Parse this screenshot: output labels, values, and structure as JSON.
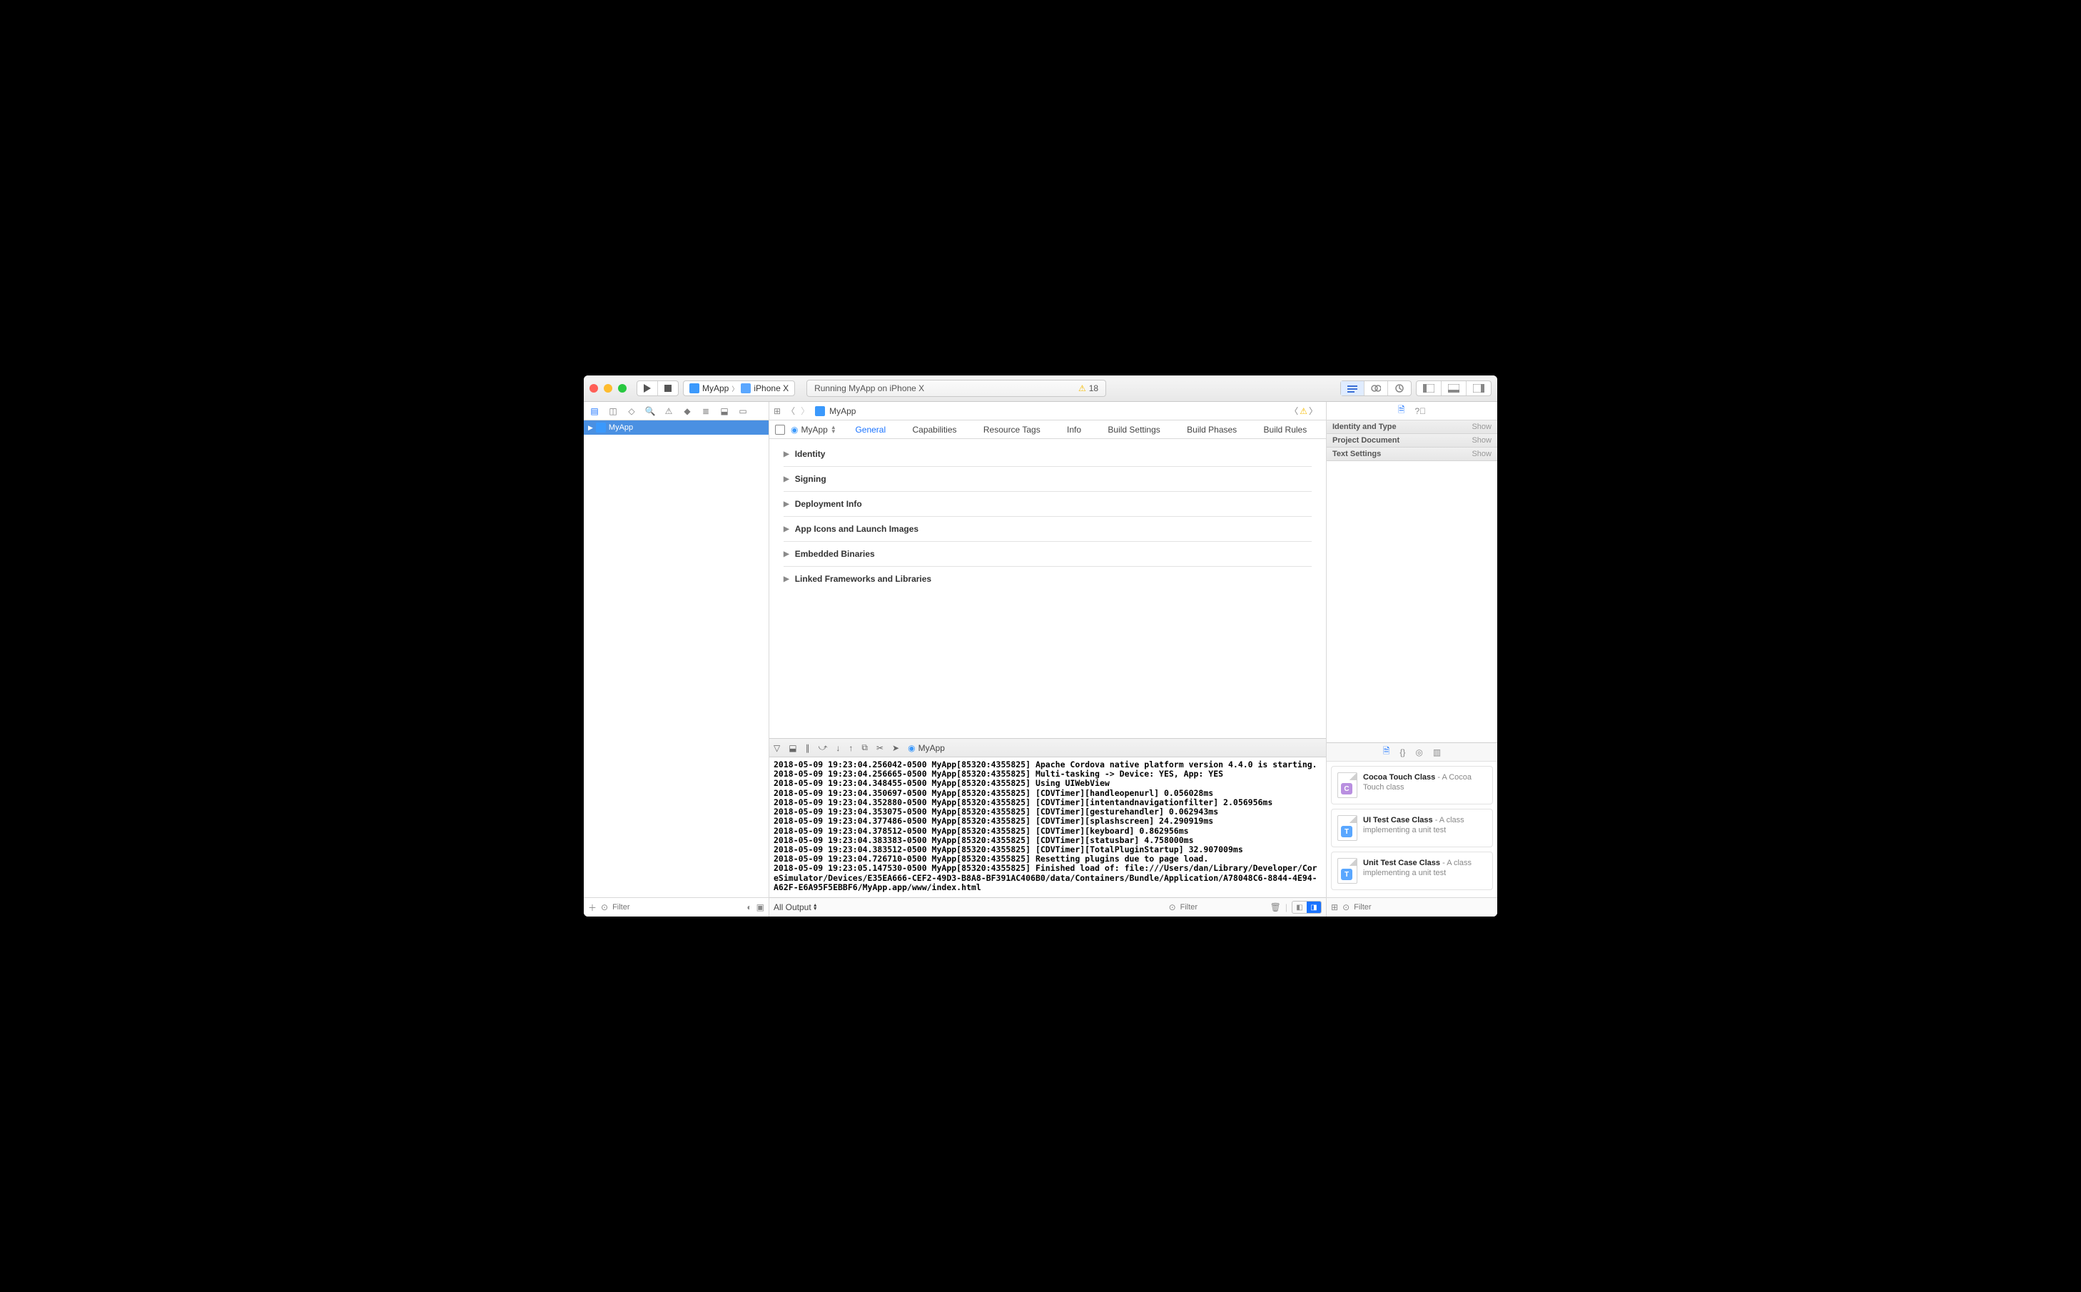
{
  "toolbar": {
    "scheme_app": "MyApp",
    "scheme_device": "iPhone X",
    "status": "Running MyApp on iPhone X",
    "warning_count": "18"
  },
  "jumpbar": {
    "project": "MyApp"
  },
  "navigator": {
    "root": "MyApp",
    "filter_placeholder": "Filter"
  },
  "editor": {
    "target": "MyApp",
    "tabs": [
      "General",
      "Capabilities",
      "Resource Tags",
      "Info",
      "Build Settings",
      "Build Phases",
      "Build Rules"
    ],
    "sections": [
      "Identity",
      "Signing",
      "Deployment Info",
      "App Icons and Launch Images",
      "Embedded Binaries",
      "Linked Frameworks and Libraries"
    ]
  },
  "inspector": {
    "sections": [
      "Identity and Type",
      "Project Document",
      "Text Settings"
    ],
    "show": "Show"
  },
  "debug": {
    "process": "MyApp",
    "output_scope": "All Output",
    "filter_placeholder": "Filter",
    "lines": [
      "2018-05-09 19:23:04.256042-0500 MyApp[85320:4355825] Apache Cordova native platform version 4.4.0 is starting.",
      "2018-05-09 19:23:04.256665-0500 MyApp[85320:4355825] Multi-tasking -> Device: YES, App: YES",
      "2018-05-09 19:23:04.348455-0500 MyApp[85320:4355825] Using UIWebView",
      "2018-05-09 19:23:04.350697-0500 MyApp[85320:4355825] [CDVTimer][handleopenurl] 0.056028ms",
      "2018-05-09 19:23:04.352880-0500 MyApp[85320:4355825] [CDVTimer][intentandnavigationfilter] 2.056956ms",
      "2018-05-09 19:23:04.353075-0500 MyApp[85320:4355825] [CDVTimer][gesturehandler] 0.062943ms",
      "2018-05-09 19:23:04.377486-0500 MyApp[85320:4355825] [CDVTimer][splashscreen] 24.290919ms",
      "2018-05-09 19:23:04.378512-0500 MyApp[85320:4355825] [CDVTimer][keyboard] 0.862956ms",
      "2018-05-09 19:23:04.383383-0500 MyApp[85320:4355825] [CDVTimer][statusbar] 4.758000ms",
      "2018-05-09 19:23:04.383512-0500 MyApp[85320:4355825] [CDVTimer][TotalPluginStartup] 32.907009ms",
      "2018-05-09 19:23:04.726710-0500 MyApp[85320:4355825] Resetting plugins due to page load.",
      "2018-05-09 19:23:05.147530-0500 MyApp[85320:4355825] Finished load of: file:///Users/dan/Library/Developer/CoreSimulator/Devices/E35EA666-CEF2-49D3-B8A8-BF391AC406B0/data/Containers/Bundle/Application/A78048C6-8844-4E94-A62F-E6A95F5EBBF6/MyApp.app/www/index.html"
    ]
  },
  "library": {
    "filter_placeholder": "Filter",
    "items": [
      {
        "badge": "C",
        "color": "#b98fe0",
        "title": "Cocoa Touch Class",
        "desc": "A Cocoa Touch class"
      },
      {
        "badge": "T",
        "color": "#5aa7ff",
        "title": "UI Test Case Class",
        "desc": "A class implementing a unit test"
      },
      {
        "badge": "T",
        "color": "#5aa7ff",
        "title": "Unit Test Case Class",
        "desc": "A class implementing a unit test"
      }
    ]
  }
}
